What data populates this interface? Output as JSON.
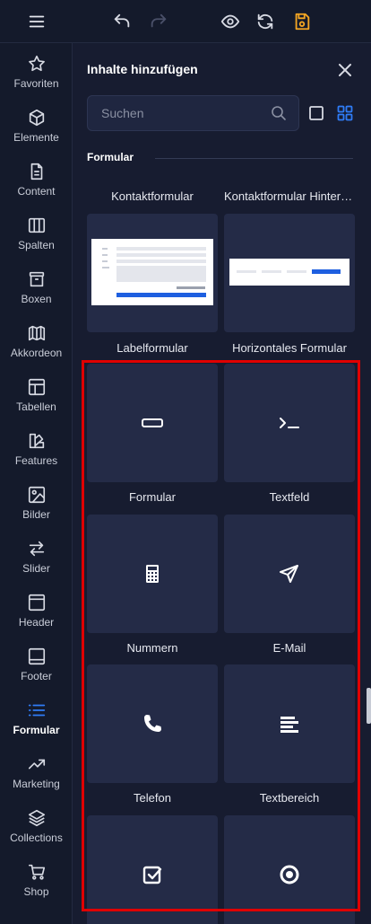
{
  "toolbar": {
    "icons": [
      "menu-icon",
      "undo-icon",
      "redo-icon",
      "preview-icon",
      "refresh-icon",
      "save-icon"
    ],
    "accent_save": "#f5a623"
  },
  "sidebar": {
    "items": [
      {
        "label": "Favoriten",
        "icon": "star-icon"
      },
      {
        "label": "Elemente",
        "icon": "cube-icon"
      },
      {
        "label": "Content",
        "icon": "document-icon"
      },
      {
        "label": "Spalten",
        "icon": "columns-icon"
      },
      {
        "label": "Boxen",
        "icon": "box-icon"
      },
      {
        "label": "Akkordeon",
        "icon": "accordion-icon"
      },
      {
        "label": "Tabellen",
        "icon": "table-icon"
      },
      {
        "label": "Features",
        "icon": "features-icon"
      },
      {
        "label": "Bilder",
        "icon": "image-icon"
      },
      {
        "label": "Slider",
        "icon": "slider-icon"
      },
      {
        "label": "Header",
        "icon": "header-icon"
      },
      {
        "label": "Footer",
        "icon": "footer-icon"
      },
      {
        "label": "Formular",
        "icon": "list-icon",
        "active": true
      },
      {
        "label": "Marketing",
        "icon": "trend-icon"
      },
      {
        "label": "Collections",
        "icon": "layers-icon"
      },
      {
        "label": "Shop",
        "icon": "cart-icon"
      }
    ],
    "active_color": "#2f7cf6"
  },
  "panel": {
    "title": "Inhalte hinzufügen",
    "search_placeholder": "Suchen",
    "section": "Formular",
    "templates": [
      {
        "label": "Kontaktformular"
      },
      {
        "label": "Kontaktformular Hintergrund"
      },
      {
        "label": "Labelformular"
      },
      {
        "label": "Horizontales Formular"
      }
    ],
    "elements": [
      {
        "label": "Formular",
        "icon": "input-field-icon"
      },
      {
        "label": "Textfeld",
        "icon": "terminal-icon"
      },
      {
        "label": "Nummern",
        "icon": "calculator-icon"
      },
      {
        "label": "E-Mail",
        "icon": "send-icon"
      },
      {
        "label": "Telefon",
        "icon": "phone-icon"
      },
      {
        "label": "Textbereich",
        "icon": "textarea-icon"
      },
      {
        "label": "",
        "icon": "checkbox-icon"
      },
      {
        "label": "",
        "icon": "radio-icon"
      }
    ]
  }
}
